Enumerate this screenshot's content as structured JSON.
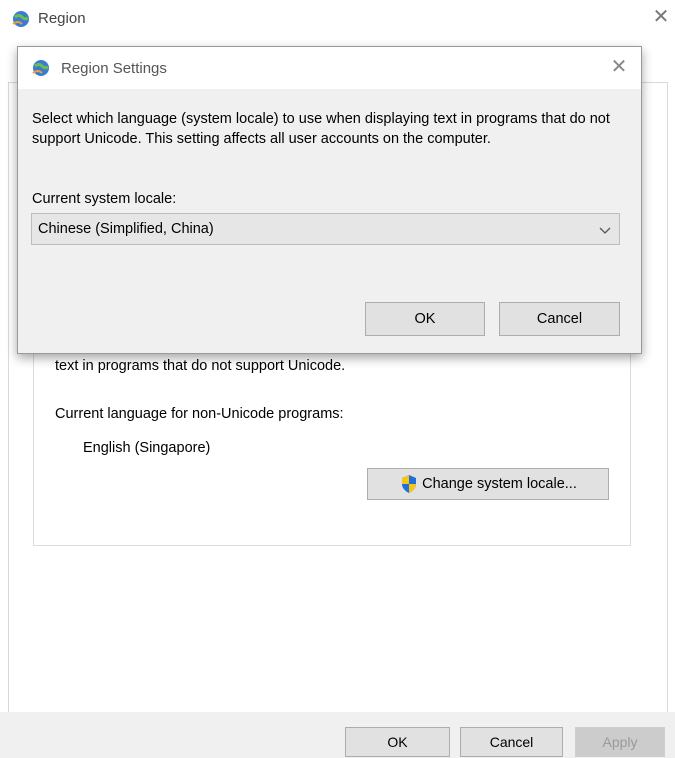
{
  "region_window": {
    "title": "Region",
    "close_icon": "close-icon",
    "nonunicode": {
      "description": "text in programs that do not support Unicode.",
      "current_label": "Current language for non-Unicode programs:",
      "current_value": "English (Singapore)",
      "change_button": "Change system locale..."
    },
    "footer": {
      "ok": "OK",
      "cancel": "Cancel",
      "apply": "Apply"
    }
  },
  "settings_dialog": {
    "title": "Region Settings",
    "description": "Select which language (system locale) to use when displaying text in programs that do not support Unicode. This setting affects all user accounts on the computer.",
    "locale_label": "Current system locale:",
    "locale_value": "Chinese (Simplified, China)",
    "ok": "OK",
    "cancel": "Cancel"
  },
  "colors": {
    "dialog_bg": "#f0f0f0",
    "button_bg": "#e1e1e1",
    "shield_blue": "#1f6fd6",
    "shield_yellow": "#f5c518"
  }
}
